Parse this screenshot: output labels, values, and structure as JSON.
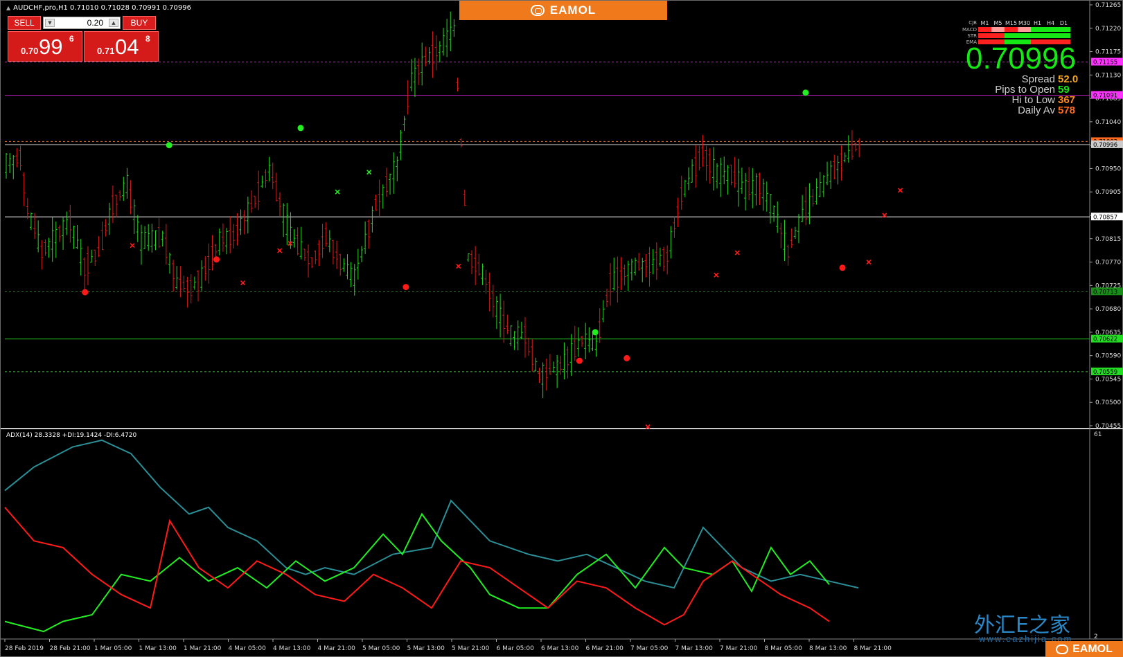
{
  "window": {
    "symbol_title": "AUDCHF,pro,H1  0.71010 0.71028 0.70991 0.70996"
  },
  "brand": {
    "banner_text": "EAMOL",
    "corner_text": "EAMOL",
    "watermark_cn": "外汇E之家",
    "watermark_url": "www.eazhijia.com"
  },
  "trade_panel": {
    "sell_label": "SELL",
    "buy_label": "BUY",
    "lot_value": "0.20",
    "sell_price": {
      "small": "0.70",
      "big": "99",
      "sup": "6"
    },
    "buy_price": {
      "small": "0.71",
      "big": "04",
      "sup": "8"
    }
  },
  "signal_table": {
    "columns": [
      "CJB",
      "M1",
      "M5",
      "M15",
      "M30",
      "H1",
      "H4",
      "D1"
    ],
    "rows": [
      {
        "label": "MACD",
        "cells": [
          "#ff2020",
          "#ff9a9a",
          "#ff2020",
          "#ff9a9a",
          "#15e815",
          "#15e815",
          "#15e815"
        ]
      },
      {
        "label": "STR",
        "cells": [
          "#ff2020",
          "#ff2020",
          "#15e815",
          "#15e815",
          "#15e815",
          "#15e815",
          "#15e815"
        ]
      },
      {
        "label": "EMA",
        "cells": [
          "#ff2020",
          "#ff2020",
          "#15e815",
          "#15e815",
          "#ff2020",
          "#ff2020",
          "#ff2020"
        ]
      }
    ]
  },
  "stats": {
    "price": "0.70996",
    "spread_label": "Spread",
    "spread_value": "52.0",
    "spread_color": "#f5a623",
    "pips_label": "Pips to Open",
    "pips_value": "59",
    "pips_color": "#15e815",
    "hilo_label": "Hi to Low",
    "hilo_value": "367",
    "hilo_color": "#ff8a1a",
    "daily_label": "Daily Av",
    "daily_value": "578",
    "daily_color": "#ff6a1a"
  },
  "price_axis": {
    "ticks": [
      "0.71265",
      "0.71220",
      "0.71175",
      "0.71130",
      "0.71085",
      "0.71040",
      "0.70995",
      "0.70950",
      "0.70905",
      "0.70860",
      "0.70815",
      "0.70770",
      "0.70725",
      "0.70680",
      "0.70635",
      "0.70590",
      "0.70545",
      "0.70500",
      "0.70455"
    ],
    "badges": [
      {
        "text": "0.71155",
        "color": "#ff33ff",
        "level": 0.71155
      },
      {
        "text": "0.71091",
        "color": "#ff33ff",
        "level": 0.71091
      },
      {
        "text": "0.71002",
        "color": "#ff6a1a",
        "level": 0.71002
      },
      {
        "text": "0.70996",
        "color": "#cccccc",
        "level": 0.70996
      },
      {
        "text": "0.70857",
        "color": "#ffffff",
        "level": 0.70857
      },
      {
        "text": "0.70713",
        "color": "#1a8c1a",
        "level": 0.70713
      },
      {
        "text": "0.70622",
        "color": "#22dd22",
        "level": 0.70622
      },
      {
        "text": "0.70559",
        "color": "#22dd22",
        "level": 0.70559
      }
    ]
  },
  "levels": [
    {
      "price": 0.71155,
      "color": "#cc22cc",
      "dash": true
    },
    {
      "price": 0.71091,
      "color": "#cc22cc",
      "dash": false
    },
    {
      "price": 0.71002,
      "color": "#ff6a1a",
      "dash": true
    },
    {
      "price": 0.70996,
      "color": "#bbbbbb",
      "dash": false
    },
    {
      "price": 0.70857,
      "color": "#ffffff",
      "dash": false
    },
    {
      "price": 0.70713,
      "color": "#1a8c1a",
      "dash": true
    },
    {
      "price": 0.70622,
      "color": "#22cc22",
      "dash": false
    },
    {
      "price": 0.70559,
      "color": "#22cc22",
      "dash": true
    }
  ],
  "time_axis": {
    "labels": [
      "28 Feb 2019",
      "28 Feb 21:00",
      "1 Mar 05:00",
      "1 Mar 13:00",
      "1 Mar 21:00",
      "4 Mar 05:00",
      "4 Mar 13:00",
      "4 Mar 21:00",
      "5 Mar 05:00",
      "5 Mar 13:00",
      "5 Mar 21:00",
      "6 Mar 05:00",
      "6 Mar 13:00",
      "6 Mar 21:00",
      "7 Mar 05:00",
      "7 Mar 13:00",
      "7 Mar 21:00",
      "8 Mar 05:00",
      "8 Mar 13:00",
      "8 Mar 21:00"
    ]
  },
  "adx": {
    "label": "ADX(14) 28.3328 +DI:19.1424 -DI:6.4720",
    "scale_max": "61",
    "scale_min": "2"
  },
  "chart_data": {
    "type": "candlestick",
    "symbol": "AUDCHF",
    "timeframe": "H1",
    "ylim": [
      0.70455,
      0.71265
    ],
    "bar_count": 150,
    "anchors": [
      [
        0,
        0.7096
      ],
      [
        4,
        0.7097
      ],
      [
        6,
        0.7087
      ],
      [
        10,
        0.7079
      ],
      [
        14,
        0.7082
      ],
      [
        18,
        0.7085
      ],
      [
        22,
        0.7076
      ],
      [
        26,
        0.7079
      ],
      [
        30,
        0.7088
      ],
      [
        34,
        0.7092
      ],
      [
        38,
        0.7081
      ],
      [
        44,
        0.7082
      ],
      [
        48,
        0.7073
      ],
      [
        52,
        0.7072
      ],
      [
        55,
        0.7074
      ],
      [
        60,
        0.7081
      ],
      [
        64,
        0.7082
      ],
      [
        70,
        0.7089
      ],
      [
        74,
        0.7095
      ],
      [
        80,
        0.7082
      ],
      [
        86,
        0.7077
      ],
      [
        90,
        0.7082
      ],
      [
        94,
        0.7077
      ],
      [
        98,
        0.7074
      ],
      [
        104,
        0.7088
      ],
      [
        110,
        0.7096
      ],
      [
        114,
        0.7112
      ],
      [
        118,
        0.7116
      ],
      [
        122,
        0.7118
      ],
      [
        126,
        0.7122
      ],
      [
        130,
        0.7078
      ],
      [
        134,
        0.7075
      ],
      [
        138,
        0.7068
      ],
      [
        142,
        0.7063
      ],
      [
        146,
        0.7063
      ],
      [
        150,
        0.7055
      ],
      [
        156,
        0.7057
      ],
      [
        162,
        0.7062
      ],
      [
        166,
        0.7061
      ],
      [
        170,
        0.7073
      ],
      [
        176,
        0.7076
      ],
      [
        182,
        0.7077
      ],
      [
        186,
        0.7078
      ],
      [
        190,
        0.709
      ],
      [
        196,
        0.7098
      ],
      [
        200,
        0.7094
      ],
      [
        204,
        0.7094
      ],
      [
        208,
        0.7091
      ],
      [
        212,
        0.7092
      ],
      [
        216,
        0.7087
      ],
      [
        220,
        0.7079
      ],
      [
        224,
        0.7086
      ],
      [
        228,
        0.709
      ],
      [
        232,
        0.7094
      ],
      [
        236,
        0.7097
      ],
      [
        240,
        0.71
      ]
    ],
    "markers": [
      {
        "type": "dot",
        "color": "#ff1a1a",
        "bar": 15,
        "price": 0.70712
      },
      {
        "type": "dot",
        "color": "#22ee22",
        "bar": 31,
        "price": 0.70995
      },
      {
        "type": "dot",
        "color": "#ff1a1a",
        "bar": 40,
        "price": 0.70775
      },
      {
        "type": "dot",
        "color": "#22ee22",
        "bar": 56,
        "price": 0.71028
      },
      {
        "type": "dot",
        "color": "#ff1a1a",
        "bar": 76,
        "price": 0.70722
      },
      {
        "type": "dot",
        "color": "#ff1a1a",
        "bar": 109,
        "price": 0.7058
      },
      {
        "type": "dot",
        "color": "#22ee22",
        "bar": 112,
        "price": 0.70635
      },
      {
        "type": "dot",
        "color": "#ff1a1a",
        "bar": 118,
        "price": 0.70585
      },
      {
        "type": "dot",
        "color": "#22ee22",
        "bar": 152,
        "price": 0.71096
      },
      {
        "type": "dot",
        "color": "#ff1a1a",
        "bar": 159,
        "price": 0.70759
      },
      {
        "type": "x",
        "color": "#ff1a1a",
        "bar": 24,
        "price": 0.70802
      },
      {
        "type": "x",
        "color": "#ff1a1a",
        "bar": 45,
        "price": 0.7073
      },
      {
        "type": "x",
        "color": "#ff1a1a",
        "bar": 52,
        "price": 0.70792
      },
      {
        "type": "x",
        "color": "#ff1a1a",
        "bar": 54,
        "price": 0.70806
      },
      {
        "type": "x",
        "color": "#22ee22",
        "bar": 63,
        "price": 0.70905
      },
      {
        "type": "x",
        "color": "#22ee22",
        "bar": 69,
        "price": 0.70943
      },
      {
        "type": "x",
        "color": "#ff1a1a",
        "bar": 86,
        "price": 0.70762
      },
      {
        "type": "x",
        "color": "#ff1a1a",
        "bar": 122,
        "price": 0.70453
      },
      {
        "type": "x",
        "color": "#ff1a1a",
        "bar": 135,
        "price": 0.70745
      },
      {
        "type": "x",
        "color": "#ff1a1a",
        "bar": 139,
        "price": 0.70788
      },
      {
        "type": "x",
        "color": "#ff1a1a",
        "bar": 164,
        "price": 0.7077
      },
      {
        "type": "x",
        "color": "#ff1a1a",
        "bar": 167,
        "price": 0.7086
      },
      {
        "type": "x",
        "color": "#ff1a1a",
        "bar": 170,
        "price": 0.70908
      }
    ],
    "adx_series": {
      "ylim": [
        2,
        61
      ],
      "adx": [
        [
          0,
          45
        ],
        [
          6,
          52
        ],
        [
          14,
          58
        ],
        [
          20,
          60
        ],
        [
          26,
          56
        ],
        [
          32,
          46
        ],
        [
          38,
          38
        ],
        [
          42,
          40
        ],
        [
          46,
          34
        ],
        [
          52,
          30
        ],
        [
          58,
          22
        ],
        [
          62,
          20
        ],
        [
          66,
          22
        ],
        [
          72,
          20
        ],
        [
          80,
          26
        ],
        [
          88,
          28
        ],
        [
          92,
          42
        ],
        [
          96,
          36
        ],
        [
          100,
          30
        ],
        [
          108,
          26
        ],
        [
          114,
          24
        ],
        [
          120,
          26
        ],
        [
          126,
          22
        ],
        [
          132,
          18
        ],
        [
          138,
          16
        ],
        [
          144,
          34
        ],
        [
          148,
          28
        ],
        [
          152,
          22
        ],
        [
          158,
          18
        ],
        [
          164,
          20
        ],
        [
          170,
          18
        ],
        [
          176,
          16
        ]
      ],
      "plus_di": [
        [
          0,
          6
        ],
        [
          8,
          3
        ],
        [
          12,
          6
        ],
        [
          18,
          8
        ],
        [
          24,
          20
        ],
        [
          30,
          18
        ],
        [
          36,
          25
        ],
        [
          42,
          18
        ],
        [
          48,
          22
        ],
        [
          54,
          16
        ],
        [
          60,
          24
        ],
        [
          66,
          18
        ],
        [
          72,
          22
        ],
        [
          78,
          32
        ],
        [
          82,
          26
        ],
        [
          86,
          38
        ],
        [
          90,
          30
        ],
        [
          96,
          22
        ],
        [
          100,
          14
        ],
        [
          106,
          10
        ],
        [
          112,
          10
        ],
        [
          118,
          20
        ],
        [
          124,
          26
        ],
        [
          130,
          16
        ],
        [
          136,
          28
        ],
        [
          140,
          22
        ],
        [
          146,
          20
        ],
        [
          150,
          24
        ],
        [
          154,
          15
        ],
        [
          158,
          28
        ],
        [
          162,
          20
        ],
        [
          166,
          24
        ],
        [
          170,
          17
        ]
      ],
      "minus_di": [
        [
          0,
          40
        ],
        [
          6,
          30
        ],
        [
          12,
          28
        ],
        [
          18,
          20
        ],
        [
          24,
          14
        ],
        [
          30,
          10
        ],
        [
          34,
          36
        ],
        [
          40,
          22
        ],
        [
          46,
          16
        ],
        [
          52,
          24
        ],
        [
          58,
          20
        ],
        [
          64,
          14
        ],
        [
          70,
          12
        ],
        [
          76,
          20
        ],
        [
          82,
          16
        ],
        [
          88,
          10
        ],
        [
          94,
          24
        ],
        [
          100,
          22
        ],
        [
          106,
          16
        ],
        [
          112,
          10
        ],
        [
          118,
          18
        ],
        [
          124,
          16
        ],
        [
          130,
          10
        ],
        [
          136,
          5
        ],
        [
          140,
          8
        ],
        [
          144,
          18
        ],
        [
          150,
          24
        ],
        [
          156,
          18
        ],
        [
          160,
          14
        ],
        [
          166,
          10
        ],
        [
          170,
          6
        ]
      ]
    }
  }
}
